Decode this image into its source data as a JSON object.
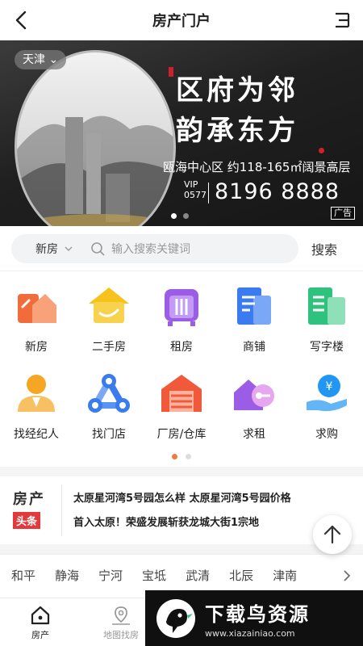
{
  "header": {
    "title": "房产门户"
  },
  "banner": {
    "city": "天津",
    "headline_line1": "区府为邻",
    "headline_line2": "韵承东方",
    "subline": "瓯海中心区 约118-165㎡阔景高层",
    "vip": "VIP",
    "area_code": "0577",
    "phone": "8196 8888",
    "ad_tag": "广告",
    "slide_count": 2,
    "active_slide": 1
  },
  "search": {
    "category": "新房",
    "placeholder": "输入搜索关键词",
    "button_label": "搜索"
  },
  "categories": [
    {
      "label": "新房",
      "icon": "new-house-icon",
      "color": "#f26b3a"
    },
    {
      "label": "二手房",
      "icon": "second-hand-house-icon",
      "color": "#f7c21c"
    },
    {
      "label": "租房",
      "icon": "rental-icon",
      "color": "#9b5de5"
    },
    {
      "label": "商铺",
      "icon": "shop-icon",
      "color": "#3a7bf0"
    },
    {
      "label": "写字楼",
      "icon": "office-building-icon",
      "color": "#2ec27e"
    },
    {
      "label": "找经纪人",
      "icon": "agent-icon",
      "color": "#f5a623"
    },
    {
      "label": "找门店",
      "icon": "store-icon",
      "color": "#3a7bf0"
    },
    {
      "label": "厂房/仓库",
      "icon": "warehouse-icon",
      "color": "#f05a3a"
    },
    {
      "label": "求租",
      "icon": "seek-rent-icon",
      "color": "#9b5de5"
    },
    {
      "label": "求购",
      "icon": "seek-buy-icon",
      "color": "#2196f3"
    }
  ],
  "grid_pager": {
    "pages": 2,
    "active": 1
  },
  "news": {
    "logo_line1": "房产",
    "logo_line2": "头条",
    "items": [
      "太原星河湾5号园怎么样  太原星河湾5号园价格",
      "首入太原！荣盛发展斩获龙城大街1宗地"
    ]
  },
  "districts": [
    "和平",
    "静海",
    "宁河",
    "宝坻",
    "武清",
    "北辰",
    "津南"
  ],
  "tabbar": [
    {
      "label": "房产",
      "icon": "home-icon",
      "active": true
    },
    {
      "label": "地图找房",
      "icon": "map-pin-icon",
      "active": false
    }
  ],
  "watermark": {
    "title": "下载鸟资源",
    "url": "www.xiazainiao.com"
  },
  "colors": {
    "accent": "#f07a3c",
    "news_red": "#e4393c"
  }
}
